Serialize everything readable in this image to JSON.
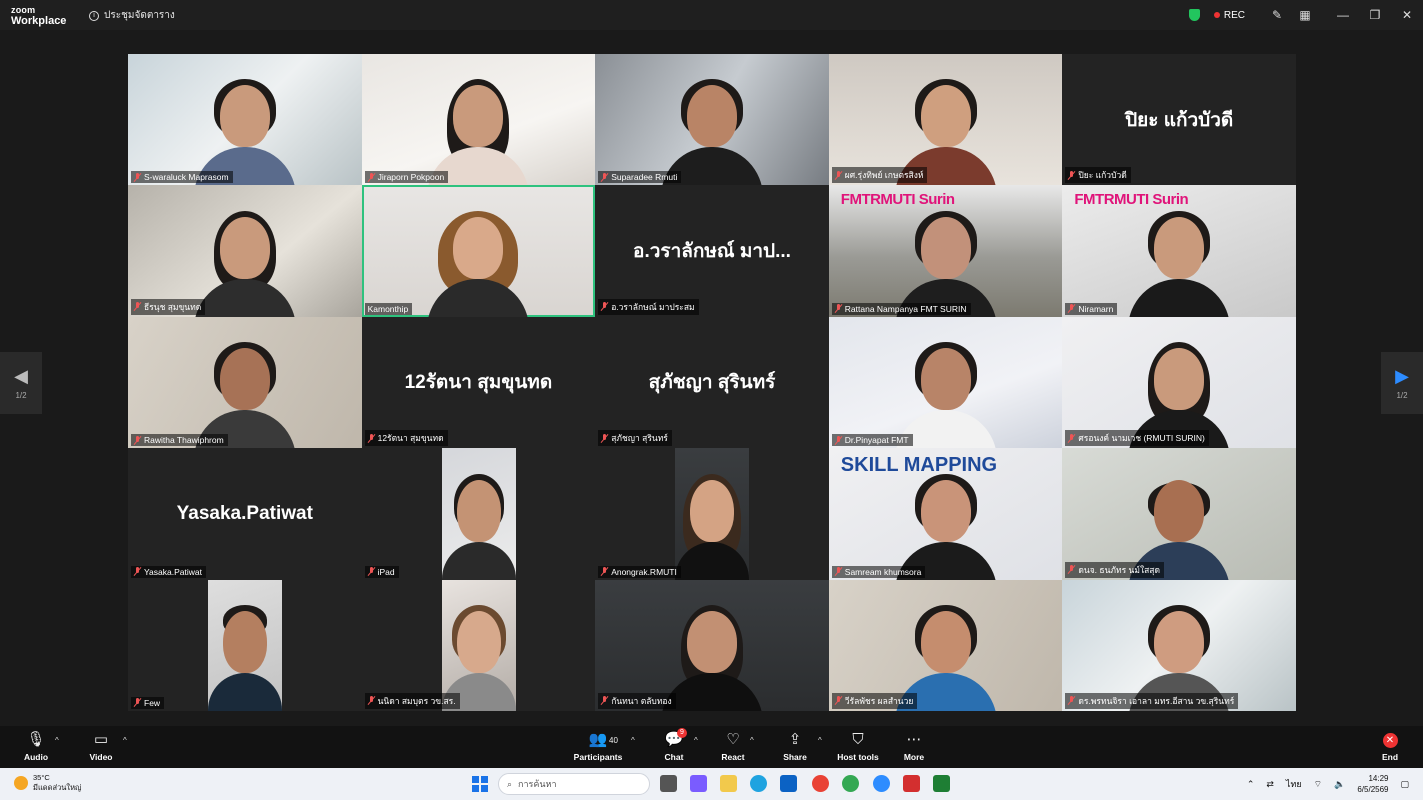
{
  "app": {
    "logo_line1": "zoom",
    "logo_line2": "Workplace",
    "meeting_info": "ประชุมจัดตาราง",
    "rec_label": "REC"
  },
  "tiles": [
    {
      "name": "S-waraluck Maprasom",
      "type": "video"
    },
    {
      "name": "Jiraporn Pokpoon",
      "type": "video"
    },
    {
      "name": "Suparadee Rmuti",
      "type": "video"
    },
    {
      "name": "ผศ.รุ่งทิพย์ เกษตรสิงห์",
      "type": "video"
    },
    {
      "name": "ปิยะ แก้วบัวดี",
      "type": "name",
      "display": "ปิยะ แก้วบัวดี"
    },
    {
      "name": "ธีรนุช สุมขุนทด",
      "type": "video"
    },
    {
      "name": "Kamonthip",
      "type": "video",
      "active": true
    },
    {
      "name": "อ.วราลักษณ์ มาประสม",
      "type": "name",
      "display": "อ.วราลักษณ์ มาป..."
    },
    {
      "name": "Rattana Nampanya FMT SURIN",
      "type": "video",
      "banner": "FMTRMUTI Surin"
    },
    {
      "name": "Niramarn",
      "type": "video",
      "banner": "FMTRMUTI Surin"
    },
    {
      "name": "Rawitha Thawiphrom",
      "type": "video"
    },
    {
      "name": "12รัตนา สุมขุนทด",
      "type": "name",
      "display": "12รัตนา สุมขุนทด"
    },
    {
      "name": "สุภัชญา สุรินทร์",
      "type": "name",
      "display": "สุภัชญา สุรินทร์"
    },
    {
      "name": "Dr.Pinyapat FMT",
      "type": "video"
    },
    {
      "name": "ศรอนงค์ นามเวช (RMUTI SURIN)",
      "type": "video"
    },
    {
      "name": "Yasaka.Patiwat",
      "type": "name",
      "display": "Yasaka.Patiwat"
    },
    {
      "name": "iPad",
      "type": "video"
    },
    {
      "name": "Anongrak.RMUTI",
      "type": "video"
    },
    {
      "name": "Samream khumsora",
      "type": "video",
      "banner": "SKILL MAPPING"
    },
    {
      "name": "ดนจ. ธนภัทร นม์ใสสุด",
      "type": "video"
    },
    {
      "name": "Few",
      "type": "video"
    },
    {
      "name": "นนิดา สมบุตร วข.สร.",
      "type": "video"
    },
    {
      "name": "กันทนา ตลับทอง",
      "type": "video"
    },
    {
      "name": "วีรัลพัชร ผลสำนวย",
      "type": "video"
    },
    {
      "name": "ดร.พรทนจิรา เอาลา มทร.อีสาน วข.สุรินทร์",
      "type": "video"
    }
  ],
  "pager": {
    "left": "1/2",
    "right": "1/2"
  },
  "toolbar": {
    "audio": "Audio",
    "video": "Video",
    "participants": "Participants",
    "participants_count": "40",
    "chat": "Chat",
    "chat_badge": "9",
    "react": "React",
    "share": "Share",
    "host_tools": "Host tools",
    "more": "More",
    "end": "End"
  },
  "taskbar": {
    "temperature": "35°C",
    "weather": "มีแดดส่วนใหญ่",
    "search_placeholder": "การค้นหา",
    "lang": "ไทย",
    "time": "14:29",
    "date": "6/5/2569"
  }
}
